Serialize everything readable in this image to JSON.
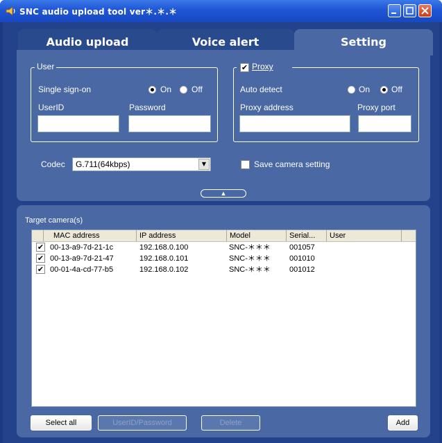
{
  "window": {
    "title": "SNC audio upload tool ver＊.＊.＊"
  },
  "tabs": [
    {
      "label": "Audio upload"
    },
    {
      "label": "Voice alert"
    },
    {
      "label": "Setting"
    }
  ],
  "user_group": {
    "title": "User",
    "single_sign_on_label": "Single sign-on",
    "on_label": "On",
    "off_label": "Off",
    "single_sign_on_value": "On",
    "userid_label": "UserID",
    "userid_value": "",
    "password_label": "Password",
    "password_value": ""
  },
  "proxy_group": {
    "title": "Proxy",
    "enabled": true,
    "auto_detect_label": "Auto detect",
    "on_label": "On",
    "off_label": "Off",
    "auto_detect_value": "Off",
    "address_label": "Proxy address",
    "address_value": "",
    "port_label": "Proxy port",
    "port_value": ""
  },
  "codec": {
    "label": "Codec",
    "value": "G.711(64kbps)"
  },
  "save_camera_setting": {
    "label": "Save camera setting",
    "checked": false
  },
  "target": {
    "title": "Target camera(s)",
    "columns": [
      "MAC address",
      "IP address",
      "Model",
      "Serial...",
      "User"
    ],
    "rows": [
      {
        "checked": true,
        "mac": "00-13-a9-7d-21-1c",
        "ip": "192.168.0.100",
        "model": "SNC-＊＊＊",
        "serial": "001057",
        "user": ""
      },
      {
        "checked": true,
        "mac": "00-13-a9-7d-21-47",
        "ip": "192.168.0.101",
        "model": "SNC-＊＊＊",
        "serial": "001010",
        "user": ""
      },
      {
        "checked": true,
        "mac": "00-01-4a-cd-77-b5",
        "ip": "192.168.0.102",
        "model": "SNC-＊＊＊",
        "serial": "001012",
        "user": ""
      }
    ]
  },
  "buttons": {
    "select_all": "Select all",
    "userid_password": "UserID/Password",
    "delete": "Delete",
    "add": "Add"
  },
  "colors": {
    "title_bar": "#1f55d4",
    "panel": "#4a69a4",
    "window_bg": "#22438c",
    "close_button": "#c93b1b"
  }
}
